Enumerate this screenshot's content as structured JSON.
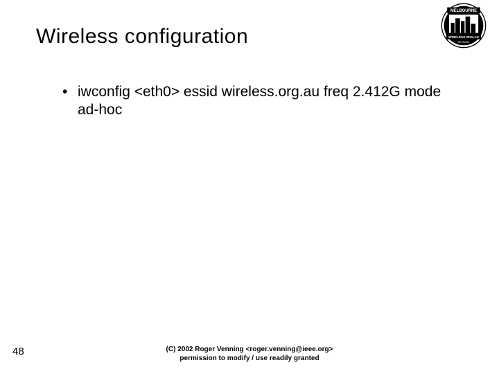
{
  "title": "Wireless configuration",
  "bullets": [
    "iwconfig <eth0> essid wireless.org.au freq 2.412G mode ad-hoc"
  ],
  "page_number": "48",
  "footer_line1": "(C) 2002 Roger Venning <roger.venning@ieee.org>",
  "footer_line2": "permission to modify / use readily granted",
  "logo": {
    "top_text": "MELBOURNE",
    "bottom_text": "WIRELESS.ORG.AU"
  }
}
